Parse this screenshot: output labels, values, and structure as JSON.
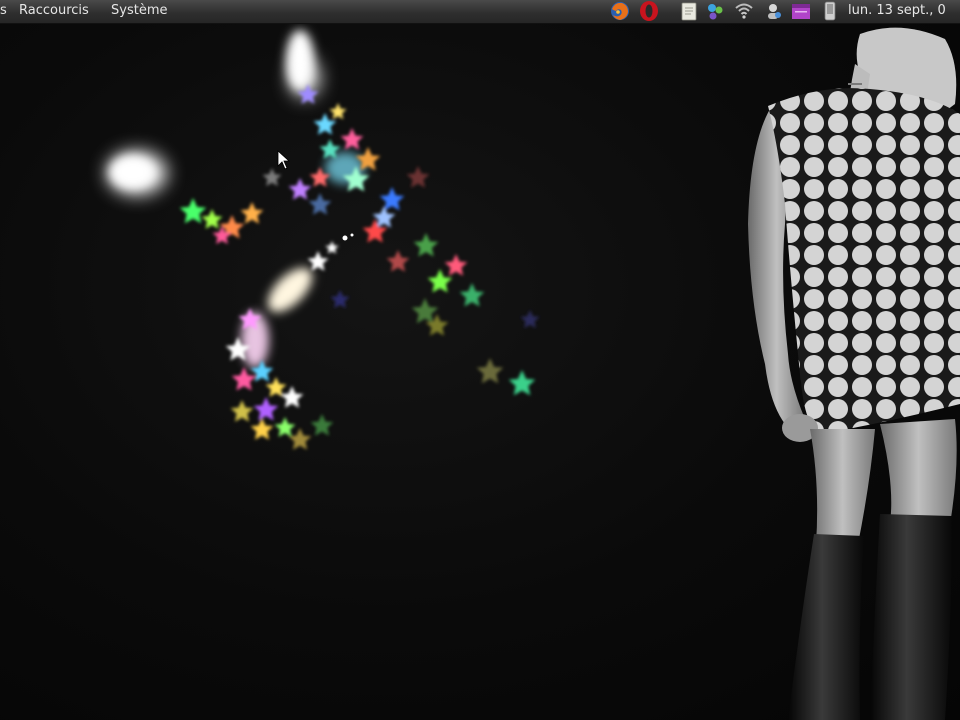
{
  "top_panel": {
    "menus": {
      "applications_truncated": "s",
      "shortcuts": "Raccourcis",
      "system": "Système"
    },
    "clock": "lun. 13 sept., 0"
  },
  "tray_icons": [
    "firefox-icon",
    "opera-icon",
    "notes-icon",
    "chat-icon",
    "wifi-icon",
    "network-icon",
    "calendar-icon",
    "battery-icon"
  ],
  "colors": {
    "panel_top": "#4a4a4a",
    "panel_bottom": "#262626",
    "desktop": "#070707",
    "panel_text": "#e6e6e6"
  }
}
